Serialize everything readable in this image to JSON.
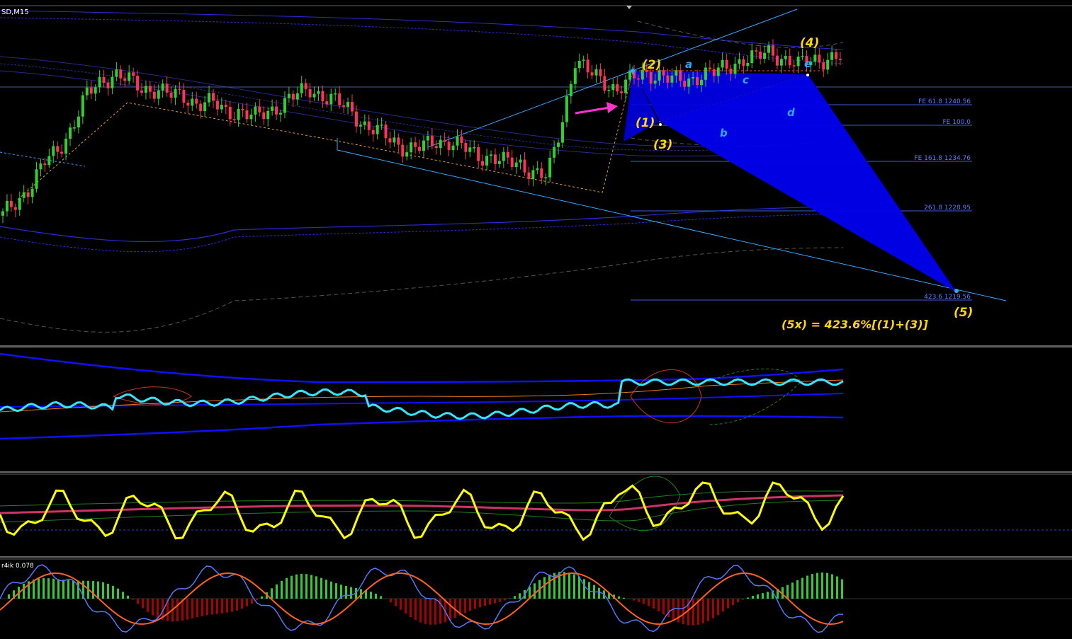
{
  "window": {
    "symbol_timeframe": "SD,M15"
  },
  "colors": {
    "background": "#000000",
    "bull_candle": "#2fd12f",
    "bear_candle": "#ff3355",
    "wave_label": "#ffd700",
    "sub_wave_label": "#33aaff",
    "harmonic_fill": "#0000ee",
    "fib_line": "#3b5bdb",
    "fib_label": "#5a7cff",
    "channel_line": "#2fa8ff",
    "arrow": "#ff33cc",
    "rsi_line": "#ffff00",
    "cyan_line": "#33e5ff",
    "bands": "#1010ff",
    "histogram_up": "#33cc33",
    "histogram_down": "#aa0000",
    "macd_line": "#ff6020",
    "signal_line": "#5577ff"
  },
  "wave_labels": {
    "w1": "(1)",
    "w2": "(2)",
    "w3": "(3)",
    "w4": "(4)",
    "w5": "(5)",
    "a": "a",
    "b": "b",
    "c": "c",
    "d": "d",
    "e": "e"
  },
  "fib_levels": [
    {
      "label": "FE 61.8 1240.56"
    },
    {
      "label": "FE 100.0"
    },
    {
      "label": "FE 161.8 1234.76"
    },
    {
      "label": "261.8 1228.95"
    },
    {
      "label": "423.6 1219.56"
    }
  ],
  "projection_formula": "(5x) = 423.6%[(1)+(3)]",
  "indicator_label": "r4ik 0.078",
  "chart_data": {
    "type": "candlestick",
    "series": [
      {
        "name": "",
        "values": [
          1224,
          1226,
          1228,
          1231,
          1233,
          1236,
          1240,
          1242,
          1243,
          1242,
          1241,
          1241,
          1240,
          1240,
          1239,
          1239,
          1238,
          1238,
          1237,
          1238,
          1239,
          1240,
          1241,
          1240,
          1239,
          1238,
          1236,
          1235,
          1234,
          1233,
          1233,
          1234,
          1234,
          1233,
          1232,
          1232,
          1231,
          1231,
          1230,
          1229,
          1236,
          1245,
          1243,
          1242,
          1241,
          1242,
          1243,
          1243,
          1242,
          1242,
          1243,
          1243,
          1244,
          1245,
          1245,
          1246,
          1245,
          1244,
          1245,
          1245,
          1245
        ]
      }
    ]
  }
}
